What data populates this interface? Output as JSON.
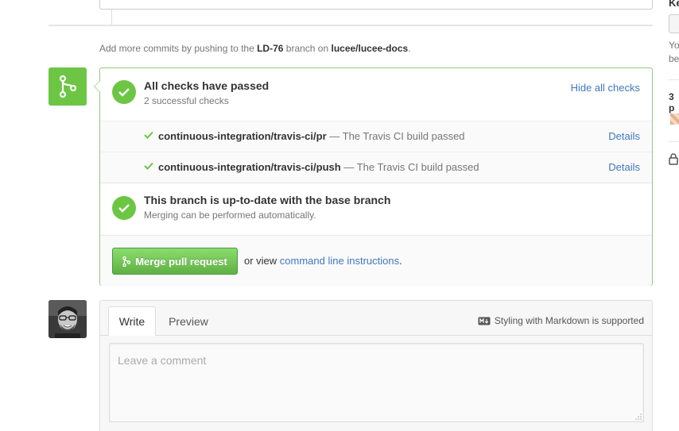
{
  "top_note": {
    "prefix": "Add more commits by pushing to the ",
    "branch": "LD-76",
    "middle": " branch on ",
    "repo": "lucee/lucee-docs",
    "suffix": "."
  },
  "checks": {
    "title": "All checks have passed",
    "subtitle": "2 successful checks",
    "hide_label": "Hide all checks",
    "items": [
      {
        "context": "continuous-integration/travis-ci/pr",
        "description": "— The Travis CI build passed",
        "details_label": "Details"
      },
      {
        "context": "continuous-integration/travis-ci/push",
        "description": "— The Travis CI build passed",
        "details_label": "Details"
      }
    ]
  },
  "branch_status": {
    "title": "This branch is up-to-date with the base branch",
    "subtitle": "Merging can be performed automatically."
  },
  "merge": {
    "button_label": "Merge pull request",
    "or_view": "or view ",
    "cli_link": "command line instructions",
    "period": "."
  },
  "comment": {
    "tab_write": "Write",
    "tab_preview": "Preview",
    "markdown_hint": "Styling with Markdown is supported",
    "placeholder": "Leave a comment"
  },
  "sidebar": {
    "heading_fragment": "Ke",
    "text_fragment_1": "Yo",
    "text_fragment_2": "be",
    "participants_fragment": "3 p"
  },
  "colors": {
    "success": "#6cc644",
    "link": "#4078c0",
    "merge_border": "#95c97e"
  }
}
